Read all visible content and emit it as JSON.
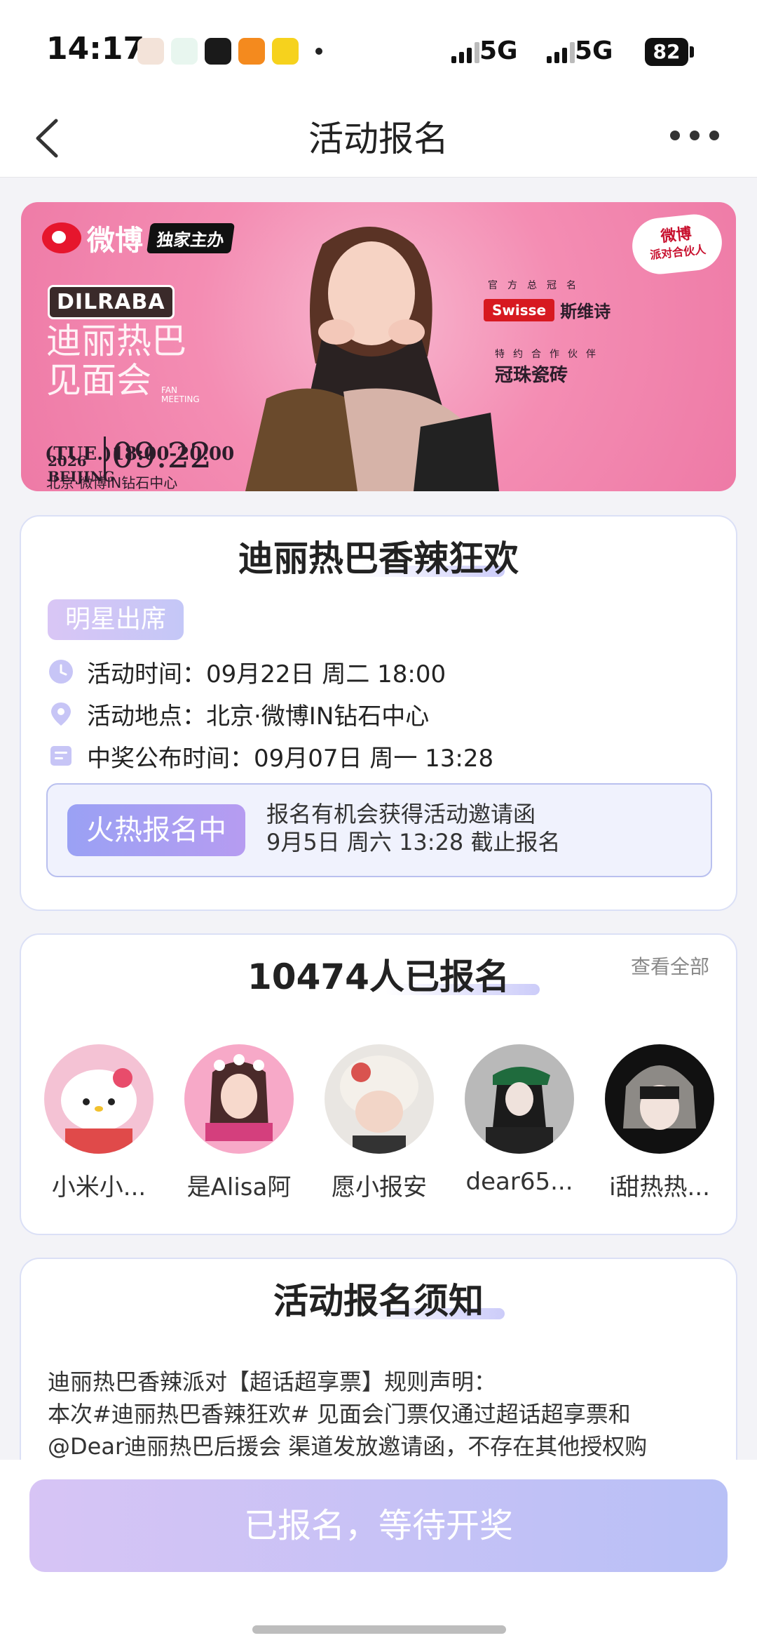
{
  "status_bar": {
    "time": "14:17",
    "net1": "5G",
    "net2": "5G",
    "battery": "82"
  },
  "nav": {
    "title": "活动报名"
  },
  "banner": {
    "weibo": "微博",
    "exclusive": "独家主办",
    "dilraba": "DILRABA",
    "name_line1": "迪丽热巴",
    "name_line2": "见面会",
    "fan_meeting": "FAN MEETING",
    "year": "2026",
    "city": "BEIJING",
    "date": "09.22",
    "time": "(TUE.)18:00-20:00",
    "place": "北京·微博IN钻石中心",
    "partner_line1": "微博",
    "partner_line2": "派对合伙人",
    "sponsor_caption": "官方总冠名",
    "swisse": "Swisse",
    "swisse_cn": "斯维诗",
    "coop_caption": "特约合作伙伴",
    "guanzhu": "冠珠瓷砖"
  },
  "event": {
    "title": "迪丽热巴香辣狂欢",
    "tag": "明星出席",
    "time_row": "活动时间：09月22日 周二 18:00",
    "location_row": "活动地点：北京·微博IN钻石中心",
    "announce_row": "中奖公布时间：09月07日 周一 13:28",
    "hot_label": "火热报名中",
    "hot_line1": "报名有机会获得活动邀请函",
    "hot_line2": "9月5日 周六 13:28 截止报名"
  },
  "signups": {
    "view_all": "查看全部",
    "count_title": "10474人已报名",
    "users": [
      {
        "name": "小米小..."
      },
      {
        "name": "是Alisa阿"
      },
      {
        "name": "愿小报安"
      },
      {
        "name": "dear65..."
      },
      {
        "name": "i甜热热..."
      }
    ]
  },
  "notice": {
    "title": "活动报名须知",
    "line1": "迪丽热巴香辣派对【超话超享票】规则声明：",
    "line2": "本次#迪丽热巴香辣狂欢# 见面会门票仅通过超话超享票和",
    "line3": "@Dear迪丽热巴后援会 渠道发放邀请函，不存在其他授权购"
  },
  "cta": {
    "label": "已报名，等待开奖"
  },
  "colors": {
    "accent": "#a7a6f3",
    "tag_gradient_start": "#d9c6f5",
    "banner_pink": "#f48db3"
  }
}
